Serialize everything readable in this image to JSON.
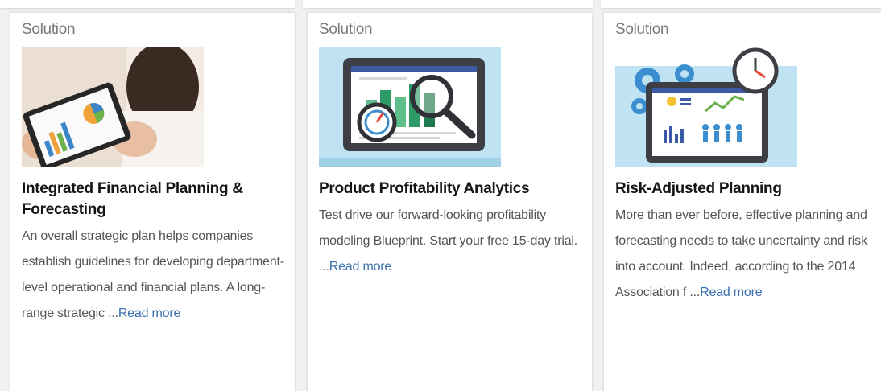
{
  "colors": {
    "page_bg": "#f1f1f1",
    "card_bg": "#ffffff",
    "link": "#3a6fb0",
    "title": "#151515",
    "body": "#555555",
    "tag": "#7a7a7a"
  },
  "cards": [
    {
      "tag": "Solution",
      "image": "tablet-chart-photo",
      "title": "Integrated Financial Planning & Forecasting",
      "description": "An overall strategic plan helps companies establish guidelines for developing department-level operational and financial plans. A long-range strategic ...",
      "read_more": "Read more"
    },
    {
      "tag": "Solution",
      "image": "profitability-dashboard-illustration",
      "title": "Product Profitability Analytics",
      "description": "Test drive our forward-looking profitability modeling Blueprint. Start your free 15-day trial. ...",
      "read_more": "Read more"
    },
    {
      "tag": "Solution",
      "image": "risk-planning-illustration",
      "title": "Risk-Adjusted Planning",
      "description": "More than ever before, effective planning and forecasting needs to take uncertainty and risk into account. Indeed, according to the 2014 Association f ...",
      "read_more": "Read more"
    }
  ]
}
